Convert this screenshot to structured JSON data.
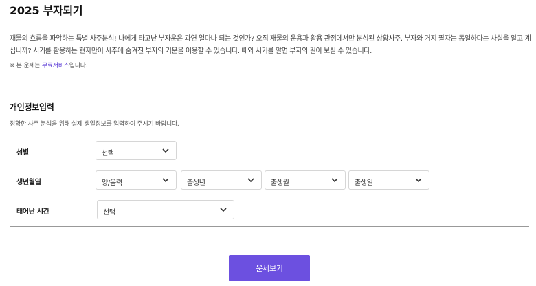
{
  "page": {
    "title": "2025 부자되기"
  },
  "intro": {
    "text": "재물의 흐름을 파악하는 특별 사주분석! 나에게 타고난 부자운은 과연 얼마나 되는 것인가? 오직 재물의 운용과 활용 관점에서만 분석된 상황사주. 부자와 거지 팔자는 동일하다는 사실을 알고 계십니까? 시기를 활용하는 현자만이 사주에 숨겨진 부자의 기운을 이용할 수 있습니다. 때와 시기를 알면 부자의 길이 보실 수 있습니다.",
    "notice_prefix": "※ 본 운세는 ",
    "notice_link": "무료서비스",
    "notice_suffix": "입니다."
  },
  "form": {
    "section_title": "개인정보입력",
    "section_desc": "정확한 사주 분석을 위해 실제 생일정보를 입력하여 주시기 바랍니다.",
    "gender": {
      "label": "성별",
      "value": "선택"
    },
    "birthdate": {
      "label": "생년월일",
      "calendar": "양/음력",
      "year": "출생년",
      "month": "출생월",
      "day": "출생일"
    },
    "birthtime": {
      "label": "태어난 시간",
      "value": "선택"
    },
    "icons": {
      "dropdown": "chevron-down-icon"
    }
  },
  "actions": {
    "submit_label": "운세보기"
  },
  "colors": {
    "accent": "#6c50e0",
    "link": "#5b3bd6"
  }
}
